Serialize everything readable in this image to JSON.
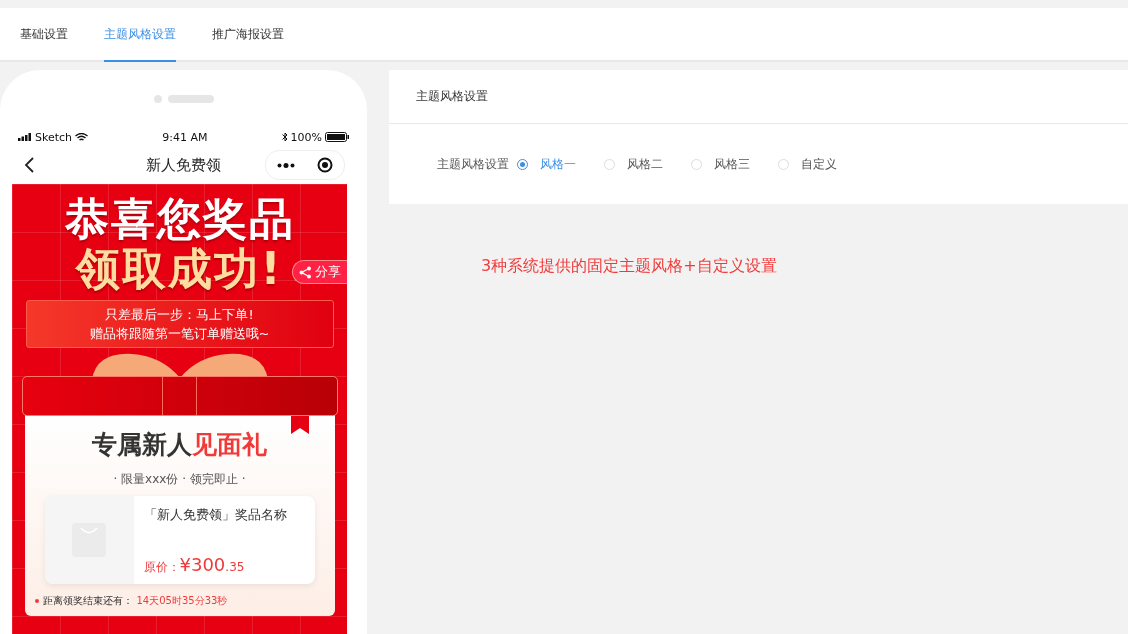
{
  "tabs": [
    {
      "label": "基础设置",
      "selected": false
    },
    {
      "label": "主题风格设置",
      "selected": true
    },
    {
      "label": "推广海报设置",
      "selected": false
    }
  ],
  "phone": {
    "status_bar": {
      "carrier": "Sketch",
      "time": "9:41 AM",
      "battery": "100%"
    },
    "nav_title": "新人免费领",
    "poster": {
      "headline": "恭喜您奖品",
      "headline_2": "领取成功!",
      "share": "分享",
      "notice": [
        "只差最后一步：马上下单!",
        "赠品将跟随第一笔订单赠送哦~"
      ],
      "gift_title": "专属新人",
      "gift_title_highlight": "见面礼",
      "subtitle": "· 限量xxx份 · 领完即止 ·",
      "product": {
        "name": "「新人免费领」奖品名称",
        "price_label": "原价：",
        "price": "¥300",
        "price_decimal": ".35"
      },
      "countdown_label": "距离领奖结束还有：",
      "countdown": "14天05时35分33秒"
    }
  },
  "panel": {
    "title": "主题风格设置",
    "field_label": "主题风格设置",
    "options": [
      {
        "label": "风格一",
        "selected": true
      },
      {
        "label": "风格二",
        "selected": false
      },
      {
        "label": "风格三",
        "selected": false
      },
      {
        "label": "自定义",
        "selected": false
      }
    ]
  },
  "note": "3种系统提供的固定主题风格+自定义设置"
}
